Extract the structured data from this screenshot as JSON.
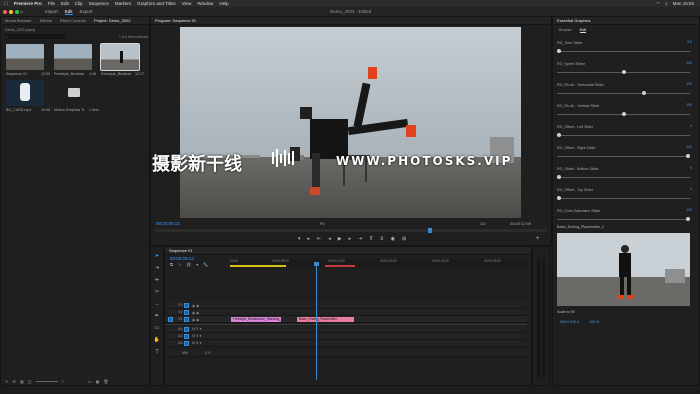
{
  "menubar": {
    "app": "Premiere Pro",
    "items": [
      "File",
      "Edit",
      "Clip",
      "Sequence",
      "Markers",
      "Graphics and Titles",
      "View",
      "Window",
      "Help"
    ],
    "clock": "Mon 15:53"
  },
  "titlebar": {
    "workspaces": [
      "Import",
      "Edit",
      "Export"
    ],
    "active_workspace": "Edit",
    "document_title": "Demo_2022 - Edited"
  },
  "project_panel": {
    "tabs": [
      "Media Browser",
      "Effects",
      "Effect Controls",
      "Project: Demo_2022"
    ],
    "project_file": "Demo_2022.prproj",
    "selection_info": "1 of 6 items selected",
    "items": [
      {
        "name": "Sequence 01",
        "duration": "12:09"
      },
      {
        "name": "Freestyle_Breakdance_Standing_Move...",
        "duration": "1:18"
      },
      {
        "name": "Freestyle_Breakdance_Standing_Move...",
        "duration": "12:17"
      },
      {
        "name": "BG_CARD.mp4",
        "duration": "10:08"
      },
      {
        "name": "Motion Graphics Templ...",
        "duration": "1 item"
      }
    ]
  },
  "program_monitor": {
    "title": "Program: Sequence 01",
    "timecode_current": "00:00:09:13",
    "timecode_duration": "00:00:12:09",
    "fit": "Fit",
    "quality": "1/2"
  },
  "watermark": {
    "cn": "摄影新干线",
    "en": "WWW.PHOTOSKS.VIP"
  },
  "timeline": {
    "tab": "Sequence 01",
    "timecode": "00:00:09:13",
    "ruler": [
      "00:00",
      "00:00:05:00",
      "00:00:10:00",
      "00:00:15:00",
      "00:00:20:00",
      "00:00:25:00"
    ],
    "video_tracks": [
      "V3",
      "V2",
      "V1"
    ],
    "audio_tracks": [
      "A1",
      "A2",
      "A3"
    ],
    "mix_label": "Mix",
    "mix_value": "0.0",
    "clips": [
      {
        "label": "Freestyle_Breakdance_Standing_Move...",
        "track": "V1",
        "color": "#d983d9"
      },
      {
        "label": "Basic_Ending_Placeholder",
        "track": "V1",
        "color": "#e97b9c"
      }
    ]
  },
  "essential_graphics": {
    "title": "Essential Graphics",
    "tabs": [
      "Browse",
      "Edit"
    ],
    "active_tab": "Edit",
    "controls": [
      {
        "label": "RG_Time Slider",
        "value": "0.0",
        "level": 0.0
      },
      {
        "label": "RG_Speed Slider",
        "value": "100",
        "level": 0.5
      },
      {
        "label": "RG_Rb.Ab - Horizontal Slider",
        "value": "100",
        "level": 0.66
      },
      {
        "label": "RG_Rb.Ab - Vertical Slider",
        "value": "100",
        "level": 0.5
      },
      {
        "label": "RG_Offset - Left Slider",
        "value": "0",
        "level": 0.0
      },
      {
        "label": "RG_Offset - Right Slider",
        "value": "100",
        "level": 1.0
      },
      {
        "label": "RG_Offset - Bottom Slider",
        "value": "0",
        "level": 0.0
      },
      {
        "label": "RG_Offset - Top Slider",
        "value": "0",
        "level": 0.0
      },
      {
        "label": "RG_Color Saturation Slider",
        "value": "100",
        "level": 1.0
      }
    ],
    "layer_label": "Basic_Ending_Placeholder_2",
    "scale_label": "Scale to fill",
    "opacity": "100 %",
    "position": "960.0 540.0"
  },
  "colors": {
    "accent": "#2f8fe8",
    "clip_pink": "#d983d9",
    "clip_rose": "#e97b9c",
    "playhead": "#3a8ad0"
  }
}
